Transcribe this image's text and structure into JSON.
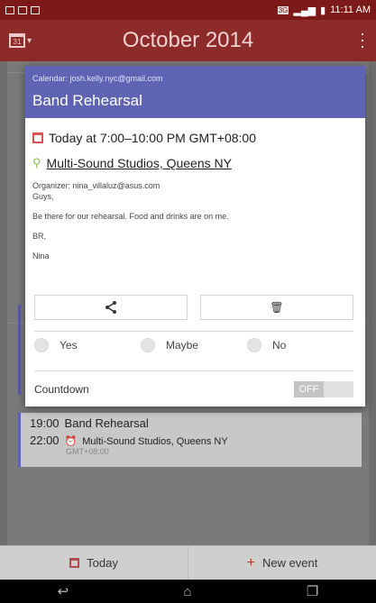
{
  "status_bar": {
    "time": "11:11 AM",
    "network": "3G"
  },
  "app_bar": {
    "title": "October 2014",
    "calendar_icon_text": "31"
  },
  "dialog": {
    "calendar_account": "Calendar: josh.kelly.nyc@gmail.com",
    "title": "Band Rehearsal",
    "when": "Today at 7:00–10:00 PM GMT+08:00",
    "where": "Multi-Sound Studios, Queens NY",
    "organizer": "Organizer: nina_villaluz@asus.com",
    "description": [
      "Guys,",
      "Be there for our rehearsal. Food and drinks are on me.",
      "BR,",
      "Nina"
    ],
    "rsvp": [
      "Yes",
      "Maybe",
      "No"
    ],
    "countdown_label": "Countdown",
    "countdown_state": "OFF",
    "header_color": "#5f63b3"
  },
  "event_list_item": {
    "start": "19:00",
    "title": "Band Rehearsal",
    "end": "22:00",
    "location": "Multi-Sound Studios, Queens NY",
    "timezone": "GMT+08:00"
  },
  "bottom_bar": {
    "today_label": "Today",
    "new_event_label": "New event"
  },
  "icons": {
    "share": "share-icon",
    "delete": "trash-icon",
    "location": "location-pin-icon",
    "calendar": "calendar-icon",
    "alarm": "alarm-icon"
  }
}
